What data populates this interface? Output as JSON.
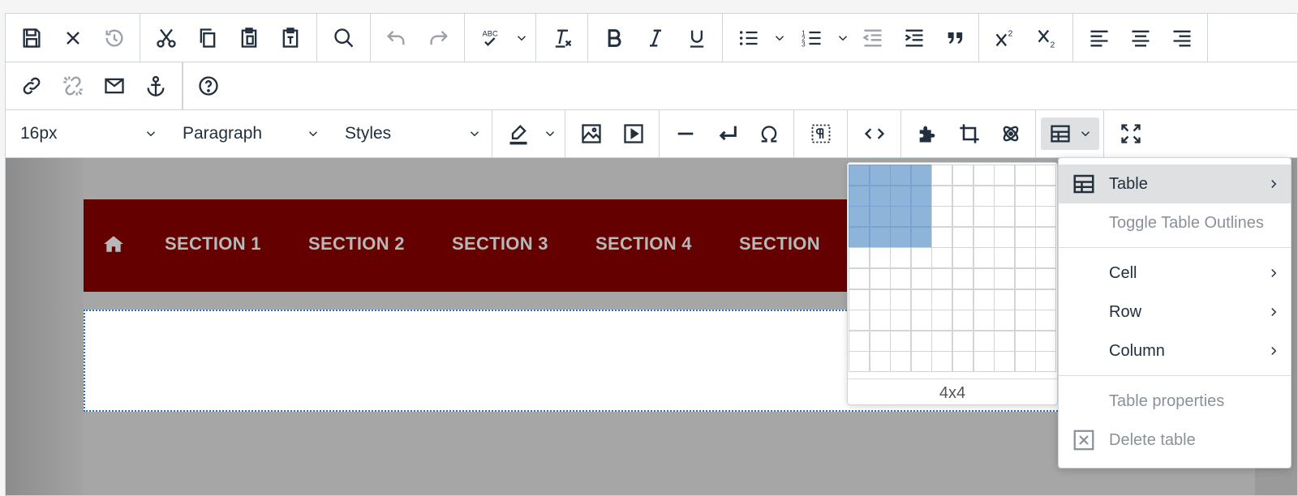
{
  "toolbar": {
    "font_size": "16px",
    "block_format": "Paragraph",
    "styles": "Styles"
  },
  "nav": {
    "items": [
      "SECTION 1",
      "SECTION 2",
      "SECTION 3",
      "SECTION 4",
      "SECTION"
    ]
  },
  "table_grid": {
    "label": "4x4",
    "rows_selected": 4,
    "cols_selected": 4,
    "rows": 10,
    "cols": 10
  },
  "table_menu": {
    "table": "Table",
    "toggle_outlines": "Toggle Table Outlines",
    "cell": "Cell",
    "row": "Row",
    "column": "Column",
    "properties": "Table properties",
    "delete": "Delete table"
  },
  "colors": {
    "nav_bg": "#650000",
    "grid_selected": "#8fb4d9",
    "content_bg": "#9a9a9a"
  }
}
